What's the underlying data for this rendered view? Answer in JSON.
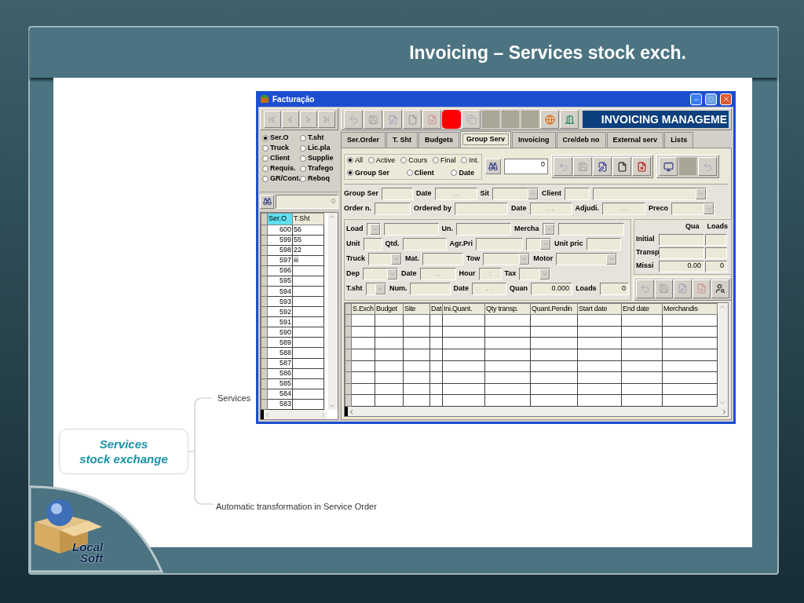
{
  "slide": {
    "title": "Invoicing – Services stock exch."
  },
  "window": {
    "title": "Facturação",
    "banner": "INVOICING MANAGEME"
  },
  "nav_buttons": [
    {
      "kind": "first",
      "disabled": true
    },
    {
      "kind": "prev",
      "disabled": true
    },
    {
      "kind": "next",
      "disabled": true
    },
    {
      "kind": "last",
      "disabled": true
    }
  ],
  "toolbar": [
    {
      "kind": "undo",
      "disabled": true
    },
    {
      "kind": "save",
      "disabled": true
    },
    {
      "kind": "edit",
      "disabled": true
    },
    {
      "kind": "new",
      "disabled": true
    },
    {
      "kind": "delete",
      "disabled": true
    },
    {
      "kind": "stop",
      "disabled": false
    },
    {
      "kind": "copy",
      "disabled": true
    },
    {
      "kind": "blank",
      "disabled": false
    },
    {
      "kind": "blank",
      "disabled": false
    },
    {
      "kind": "blank",
      "disabled": false
    },
    {
      "kind": "browser",
      "disabled": false
    },
    {
      "kind": "exit",
      "disabled": false
    }
  ],
  "search_options": [
    {
      "label": "Ser.O",
      "checked": true
    },
    {
      "label": "T.sht",
      "checked": false
    },
    {
      "label": "Truck",
      "checked": false
    },
    {
      "label": "Lic.pla",
      "checked": false
    },
    {
      "label": "Client",
      "checked": false
    },
    {
      "label": "Supplie",
      "checked": false
    },
    {
      "label": "Requis.",
      "checked": false
    },
    {
      "label": "Trafego",
      "checked": false
    },
    {
      "label": "GR/Cont.",
      "checked": false
    },
    {
      "label": "Reboq",
      "checked": false
    }
  ],
  "search_box": {
    "value": "0"
  },
  "list": {
    "columns": [
      {
        "label": "Ser.O",
        "selected": true
      },
      {
        "label": "T.Sht",
        "selected": false
      }
    ],
    "rows": [
      {
        "ser_o": "600",
        "t_sht": "56"
      },
      {
        "ser_o": "599",
        "t_sht": "55"
      },
      {
        "ser_o": "598",
        "t_sht": "22"
      },
      {
        "ser_o": "597",
        "t_sht": "iii"
      },
      {
        "ser_o": "596"
      },
      {
        "ser_o": "595"
      },
      {
        "ser_o": "594"
      },
      {
        "ser_o": "593"
      },
      {
        "ser_o": "592"
      },
      {
        "ser_o": "591"
      },
      {
        "ser_o": "590"
      },
      {
        "ser_o": "589"
      },
      {
        "ser_o": "588"
      },
      {
        "ser_o": "587"
      },
      {
        "ser_o": "586"
      },
      {
        "ser_o": "585"
      },
      {
        "ser_o": "584"
      },
      {
        "ser_o": "583"
      }
    ]
  },
  "tabs": [
    {
      "label": "Ser.Order",
      "selected": false
    },
    {
      "label": "T. Sht",
      "selected": false
    },
    {
      "label": "Budgets",
      "selected": false
    },
    {
      "label": "Group Serv",
      "selected": true
    },
    {
      "label": "Invoicing",
      "selected": false
    },
    {
      "label": "Cre/deb no",
      "selected": false
    },
    {
      "label": "External serv",
      "selected": false
    },
    {
      "label": "Lists",
      "selected": false
    }
  ],
  "filters": {
    "status": [
      {
        "label": "All",
        "checked": true
      },
      {
        "label": "Active",
        "checked": false
      },
      {
        "label": "Cours",
        "checked": false
      },
      {
        "label": "Final",
        "checked": false
      },
      {
        "label": "Int.",
        "checked": false
      }
    ],
    "order_by": [
      {
        "label": "Group Ser",
        "checked": true
      },
      {
        "label": "Client",
        "checked": false
      },
      {
        "label": "Date",
        "checked": false
      }
    ],
    "count": "0",
    "actions": [
      {
        "kind": "undo",
        "disabled": true
      },
      {
        "kind": "save",
        "disabled": true
      },
      {
        "kind": "edit",
        "disabled": false
      },
      {
        "kind": "new",
        "disabled": false
      },
      {
        "kind": "delete",
        "disabled": false
      }
    ],
    "extra_actions": [
      {
        "kind": "monitor",
        "disabled": false
      },
      {
        "kind": "blank",
        "disabled": false
      },
      {
        "kind": "undo",
        "disabled": true
      }
    ]
  },
  "form_rows": [
    [
      {
        "kind": "label",
        "text": "Group Ser"
      },
      {
        "kind": "field"
      },
      {
        "kind": "label",
        "text": "Date"
      },
      {
        "kind": "date",
        "placeholder": ". ."
      },
      {
        "kind": "label",
        "text": "Sit"
      },
      {
        "kind": "combo"
      },
      {
        "kind": "label",
        "text": "Client"
      },
      {
        "kind": "field"
      },
      {
        "kind": "combo"
      }
    ],
    [
      {
        "kind": "label",
        "text": "Order n."
      },
      {
        "kind": "field"
      },
      {
        "kind": "label",
        "text": "Ordered by"
      },
      {
        "kind": "field"
      },
      {
        "kind": "label",
        "text": "Date"
      },
      {
        "kind": "date",
        "placeholder": ". ."
      },
      {
        "kind": "label",
        "text": "Adjudi."
      },
      {
        "kind": "date",
        "placeholder": ". ."
      },
      {
        "kind": "label",
        "text": "Preco"
      },
      {
        "kind": "combo"
      }
    ]
  ],
  "load_rows": [
    [
      {
        "kind": "label",
        "text": "Load"
      },
      {
        "kind": "combo"
      },
      {
        "kind": "field"
      },
      {
        "kind": "label",
        "text": "Un."
      },
      {
        "kind": "field"
      },
      {
        "kind": "label",
        "text": "Mercha"
      },
      {
        "kind": "combo"
      },
      {
        "kind": "field"
      }
    ],
    [
      {
        "kind": "label",
        "text": "Unit"
      },
      {
        "kind": "field"
      },
      {
        "kind": "label",
        "text": "Qtd."
      },
      {
        "kind": "field"
      },
      {
        "kind": "label",
        "text": "Agr.Pri"
      },
      {
        "kind": "field"
      },
      {
        "kind": "combo"
      },
      {
        "kind": "label",
        "text": "Unit pric"
      },
      {
        "kind": "field"
      }
    ],
    [
      {
        "kind": "label",
        "text": "Truck"
      },
      {
        "kind": "combo"
      },
      {
        "kind": "label",
        "text": "Mat."
      },
      {
        "kind": "field"
      },
      {
        "kind": "label",
        "text": "Tow"
      },
      {
        "kind": "combo"
      },
      {
        "kind": "label",
        "text": "Motor"
      },
      {
        "kind": "combo"
      }
    ],
    [
      {
        "kind": "label",
        "text": "Dep"
      },
      {
        "kind": "combo"
      },
      {
        "kind": "label",
        "text": "Date"
      },
      {
        "kind": "date",
        "placeholder": ". ."
      },
      {
        "kind": "label",
        "text": "Hour"
      },
      {
        "kind": "date",
        "placeholder": ":"
      },
      {
        "kind": "label",
        "text": "Tax"
      },
      {
        "kind": "combo"
      }
    ],
    [
      {
        "kind": "label",
        "text": "T.sht"
      },
      {
        "kind": "combo"
      },
      {
        "kind": "label",
        "text": "Num."
      },
      {
        "kind": "field"
      },
      {
        "kind": "label",
        "text": "Date"
      },
      {
        "kind": "date",
        "placeholder": ". ."
      },
      {
        "kind": "label",
        "text": "Quan"
      },
      {
        "kind": "field",
        "value": "0.000"
      },
      {
        "kind": "label",
        "text": "Loads"
      },
      {
        "kind": "field",
        "value": "0"
      }
    ]
  ],
  "totals": {
    "headers": [
      "Qua",
      "Loads"
    ],
    "rows": [
      {
        "label": "Initial"
      },
      {
        "label": "Transp"
      },
      {
        "label": "Missi",
        "quantity": "0.00",
        "loads": "0"
      }
    ],
    "actions": [
      {
        "kind": "undo",
        "disabled": true
      },
      {
        "kind": "save",
        "disabled": true
      },
      {
        "kind": "edit",
        "disabled": true
      },
      {
        "kind": "delete",
        "disabled": true
      },
      {
        "kind": "finder",
        "disabled": false
      }
    ]
  },
  "table": {
    "columns": [
      "S.Exch",
      "Budget",
      "Site",
      "Dat",
      "Ini.Quant.",
      "Qty transp.",
      "Quant.Pendin",
      "Start date",
      "End date",
      "Merchandis"
    ]
  },
  "mind_map": {
    "root_lines": [
      "Services",
      "stock exchange"
    ],
    "branches": [
      "Services",
      "Automatic transformation in Service Order"
    ]
  },
  "logo": {
    "lines": [
      "Local",
      "Soft"
    ]
  }
}
